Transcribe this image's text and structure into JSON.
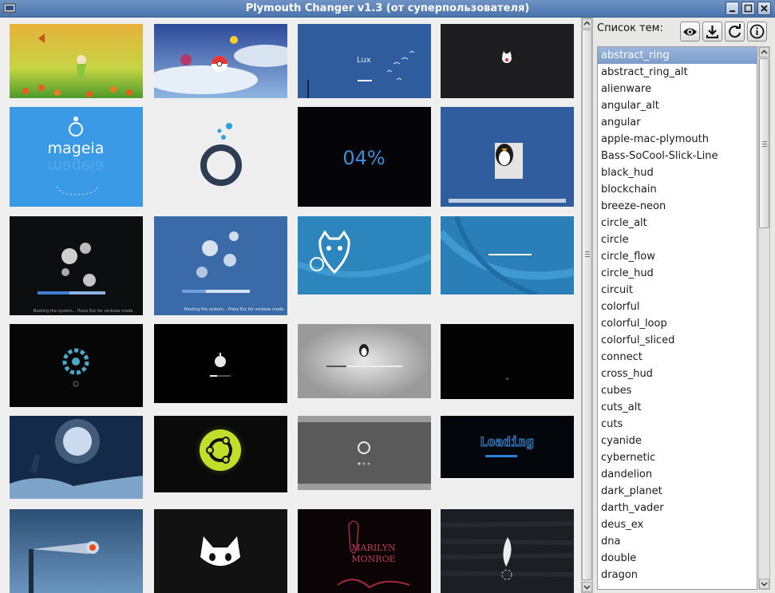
{
  "window": {
    "title": "Plymouth Changer v1.3 (от суперпользователя)"
  },
  "panel": {
    "label": "Список тем:"
  },
  "toolbar": [
    {
      "name": "preview-button",
      "icon": "eye-icon"
    },
    {
      "name": "install-button",
      "icon": "download-icon"
    },
    {
      "name": "refresh-button",
      "icon": "refresh-icon"
    },
    {
      "name": "about-button",
      "icon": "info-icon"
    }
  ],
  "themes": [
    "abstract_ring",
    "abstract_ring_alt",
    "alienware",
    "angular_alt",
    "angular",
    "apple-mac-plymouth",
    "Bass-SoCool-Slick-Line",
    "black_hud",
    "blockchain",
    "breeze-neon",
    "circle_alt",
    "circle",
    "circle_flow",
    "circle_hud",
    "circuit",
    "colorful",
    "colorful_loop",
    "colorful_sliced",
    "connect",
    "cross_hud",
    "cubes",
    "cuts_alt",
    "cuts",
    "cyanide",
    "cybernetic",
    "dandelion",
    "dark_planet",
    "darth_vader",
    "deus_ex",
    "dna",
    "double",
    "dragon"
  ],
  "selected_theme": "abstract_ring",
  "thumbnails": {
    "mageia": "mageia",
    "percent": "04%",
    "boot_text": "Booting the system... Press Esc for verbose mode.",
    "loading": "Loading",
    "marilyn_1": "MARILYN",
    "marilyn_2": "MONROE",
    "lux": "Lux"
  },
  "colors": {
    "selection": "#86a4cf",
    "titlebar": "#5b82b8"
  }
}
